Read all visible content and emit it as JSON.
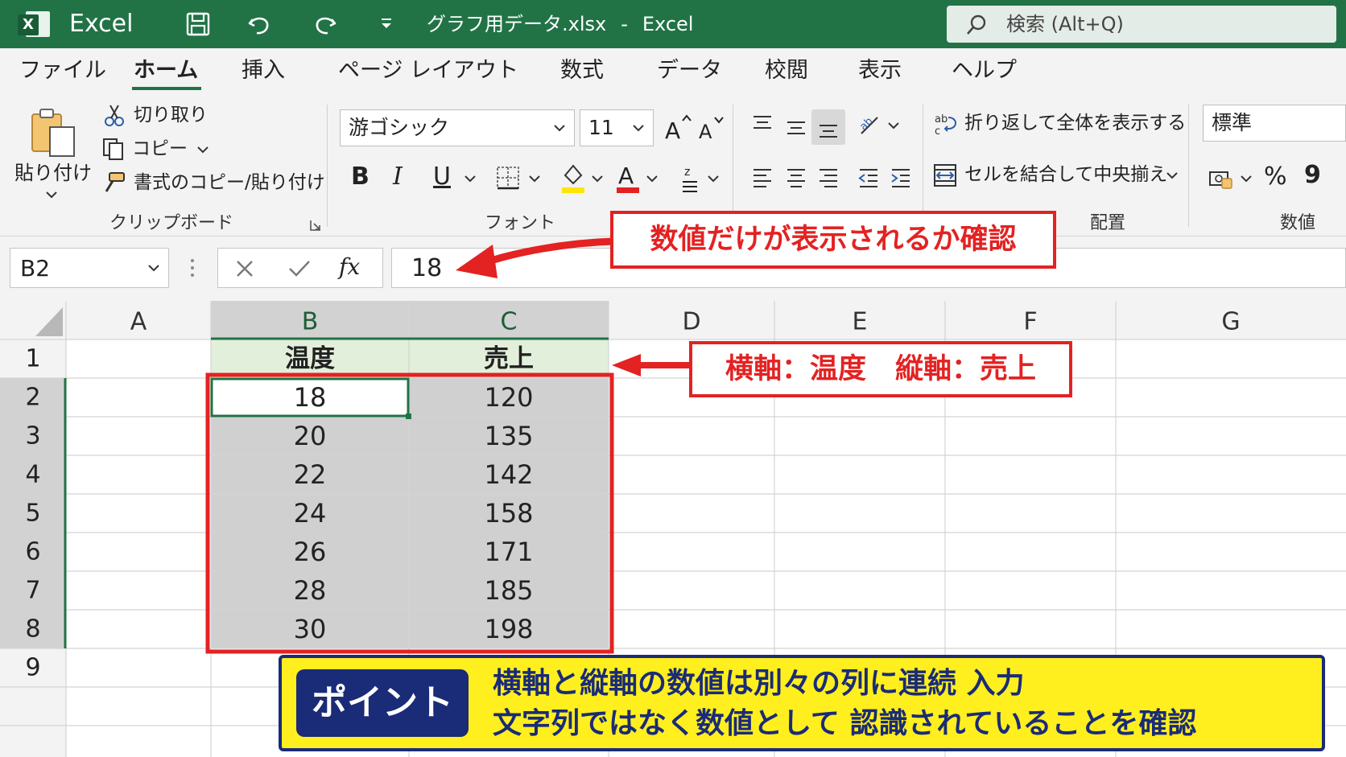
{
  "titlebar": {
    "app_name": "Excel",
    "file_name": "グラフ用データ.xlsx",
    "separator": "-",
    "app_suffix": "Excel",
    "search_placeholder": "検索 (Alt+Q)"
  },
  "tabs": [
    {
      "label": "ファイル"
    },
    {
      "label": "ホーム",
      "active": true
    },
    {
      "label": "挿入"
    },
    {
      "label": "ページ レイアウト"
    },
    {
      "label": "数式"
    },
    {
      "label": "データ"
    },
    {
      "label": "校閲"
    },
    {
      "label": "表示"
    },
    {
      "label": "ヘルプ"
    }
  ],
  "ribbon": {
    "clipboard": {
      "paste": "貼り付け",
      "cut": "切り取り",
      "copy": "コピー",
      "format_painter": "書式のコピー/貼り付け",
      "group_label": "クリップボード"
    },
    "font": {
      "font_name": "游ゴシック",
      "font_size": "11",
      "bold": "B",
      "italic": "I",
      "underline": "U",
      "group_label": "フォント"
    },
    "alignment": {
      "wrap_text": "折り返して全体を表示する",
      "merge_center": "セルを結合して中央揃え",
      "group_label": "配置"
    },
    "number": {
      "format": "標準",
      "percent": "%",
      "comma": "9",
      "group_label": "数値"
    }
  },
  "formula_bar": {
    "name_box": "B2",
    "fx": "fx",
    "value": "18"
  },
  "sheet": {
    "columns": [
      "A",
      "B",
      "C",
      "D",
      "E",
      "F",
      "G"
    ],
    "rows": [
      "1",
      "2",
      "3",
      "4",
      "5",
      "6",
      "7",
      "8",
      "9"
    ],
    "headers": [
      "温度",
      "売上"
    ],
    "data": [
      [
        "18",
        "120"
      ],
      [
        "20",
        "135"
      ],
      [
        "22",
        "142"
      ],
      [
        "24",
        "158"
      ],
      [
        "26",
        "171"
      ],
      [
        "28",
        "185"
      ],
      [
        "30",
        "198"
      ]
    ],
    "selected_cell": "B2"
  },
  "annotations": {
    "callout_value": "数値だけが表示されるか確認",
    "callout_axis_x": "横軸：温度",
    "callout_axis_y": "縦軸：売上",
    "point_tag": "ポイント",
    "point_line1": "横軸と縦軸の数値は別々の列に連続 入力",
    "point_line2": "文字列ではなく数値として 認識されていることを確認"
  },
  "colors": {
    "excel_green": "#217346",
    "callout_red": "#e32222",
    "point_yellow": "#ffef1e",
    "point_navy": "#1a2b78",
    "header_fill": "#e2efda",
    "data_fill": "#d0d0d0"
  }
}
